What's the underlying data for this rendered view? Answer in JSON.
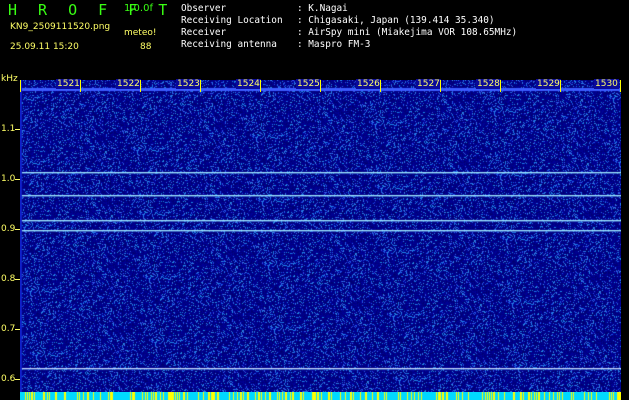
{
  "header": {
    "app_name": "H R O F F T",
    "version": "1.0.0f",
    "file_name": "KN9_2509111520.png",
    "mode": "meteo!",
    "datetime": "25.09.11 15:20",
    "count": "88",
    "info_rows": [
      {
        "label": "Observer",
        "value": ": K.Nagai"
      },
      {
        "label": "Receiving Location",
        "value": ": Chigasaki, Japan (139.414 35.340)"
      },
      {
        "label": "Receiver",
        "value": ": AirSpy mini (Miakejima VOR 108.65MHz)"
      },
      {
        "label": "Receiving antenna",
        "value": ": Maspro FM-3"
      }
    ]
  },
  "axis": {
    "y_unit": "kHz",
    "y_ticks": [
      "1.1",
      "1.0",
      "0.9",
      "0.8",
      "0.7",
      "0.6"
    ],
    "time_ticks": [
      "1521",
      "1522",
      "1523",
      "1524",
      "1525",
      "1526",
      "1527",
      "1528",
      "1529",
      "1530"
    ]
  },
  "spectrogram": {
    "background_color": "#00007a",
    "noise_color": "#2040ff",
    "carrier_lines_khz": [
      1.014,
      0.968,
      0.918,
      0.898,
      0.622
    ],
    "y_range_khz": [
      0.6,
      1.15
    ]
  }
}
